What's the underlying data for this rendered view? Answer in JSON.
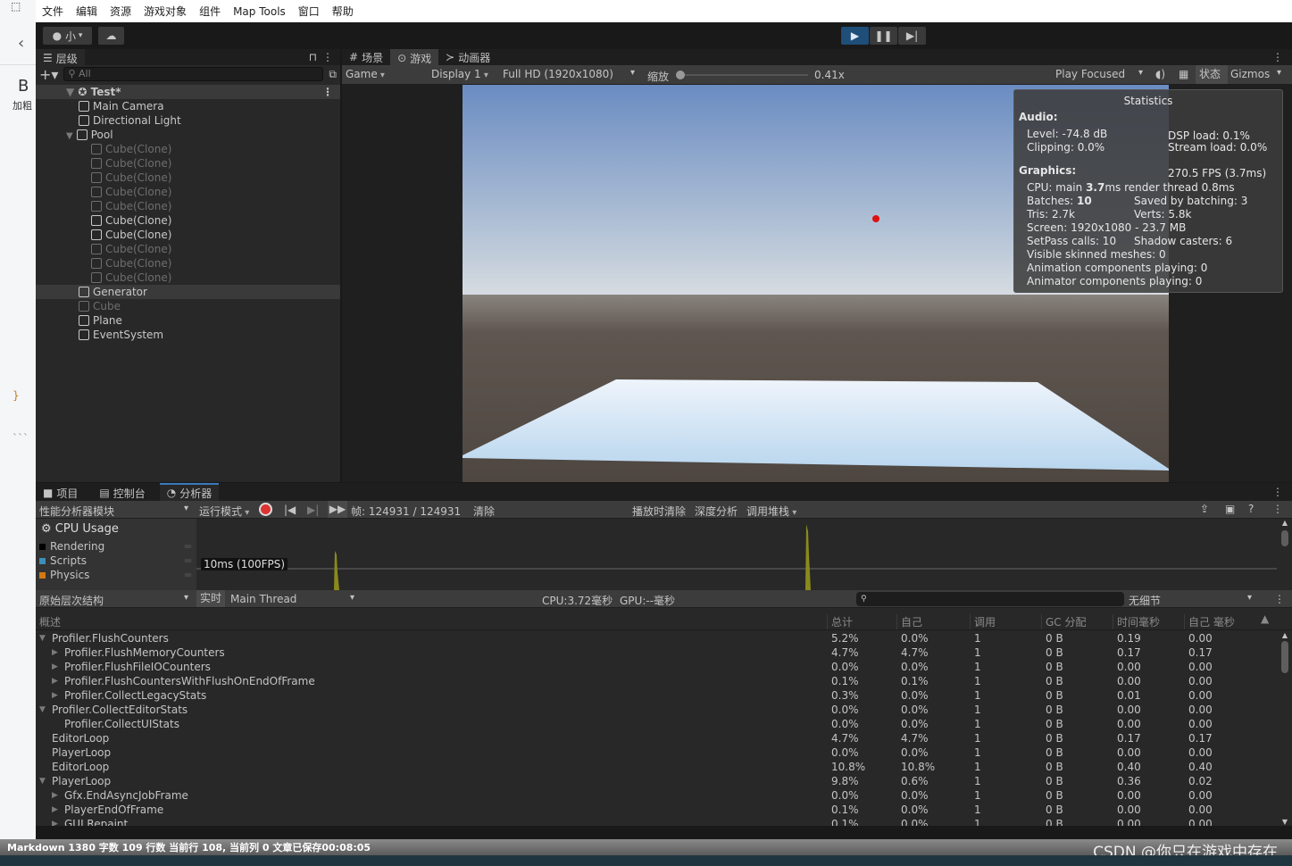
{
  "left_app": {
    "bold_icon": "B",
    "bold_label": "加粗",
    "brace": "}",
    "dots": "```"
  },
  "menu": [
    "文件",
    "编辑",
    "资源",
    "游戏对象",
    "组件",
    "Map Tools",
    "窗口",
    "帮助"
  ],
  "toolbar": {
    "account": "小",
    "play_color": "#1f4e79"
  },
  "hierarchy": {
    "tab": "层级",
    "search_placeholder": "All",
    "scene": "Test*",
    "items": [
      {
        "label": "Main Camera",
        "depth": 1,
        "active": true
      },
      {
        "label": "Directional Light",
        "depth": 1,
        "active": true
      },
      {
        "label": "Pool",
        "depth": 1,
        "active": true,
        "expanded": true
      },
      {
        "label": "Cube(Clone)",
        "depth": 2,
        "active": false
      },
      {
        "label": "Cube(Clone)",
        "depth": 2,
        "active": false
      },
      {
        "label": "Cube(Clone)",
        "depth": 2,
        "active": false
      },
      {
        "label": "Cube(Clone)",
        "depth": 2,
        "active": false
      },
      {
        "label": "Cube(Clone)",
        "depth": 2,
        "active": false
      },
      {
        "label": "Cube(Clone)",
        "depth": 2,
        "active": true
      },
      {
        "label": "Cube(Clone)",
        "depth": 2,
        "active": true
      },
      {
        "label": "Cube(Clone)",
        "depth": 2,
        "active": false
      },
      {
        "label": "Cube(Clone)",
        "depth": 2,
        "active": false
      },
      {
        "label": "Cube(Clone)",
        "depth": 2,
        "active": false
      },
      {
        "label": "Generator",
        "depth": 1,
        "active": true,
        "selected": true
      },
      {
        "label": "Cube",
        "depth": 1,
        "active": false
      },
      {
        "label": "Plane",
        "depth": 1,
        "active": true
      },
      {
        "label": "EventSystem",
        "depth": 1,
        "active": true
      }
    ]
  },
  "game": {
    "tabs": [
      "场景",
      "游戏",
      "动画器"
    ],
    "view": "Game",
    "display": "Display 1",
    "resolution": "Full HD (1920x1080)",
    "zoom_label": "缩放",
    "zoom_value": "0.41x",
    "play_focused": "Play Focused",
    "stats_btn": "状态",
    "gizmos": "Gizmos"
  },
  "stats": {
    "title": "Statistics",
    "audio": "Audio:",
    "level": "Level: -74.8 dB",
    "clipping": "Clipping: 0.0%",
    "dsp": "DSP load: 0.1%",
    "stream": "Stream load: 0.0%",
    "graphics": "Graphics:",
    "fps": "270.5 FPS (3.7ms)",
    "cpu_pre": "CPU: main ",
    "cpu_bold": "3.7",
    "cpu_post": "ms  render thread 0.8ms",
    "batches_pre": "Batches: ",
    "batches_bold": "10",
    "saved": "Saved by batching: 3",
    "tris": "Tris: 2.7k",
    "verts": "Verts: 5.8k",
    "screen": "Screen: 1920x1080 - 23.7 MB",
    "setpass": "SetPass calls: 10",
    "shadow": "Shadow casters: 6",
    "skinned": "Visible skinned meshes: 0",
    "anim": "Animation components playing: 0",
    "animator": "Animator components playing: 0"
  },
  "profiler": {
    "tabs": [
      "项目",
      "控制台",
      "分析器"
    ],
    "modules": "性能分析器模块",
    "mode": "运行模式",
    "frame": "帧:  124931 / 124931",
    "clear": "清除",
    "clear_on_play": "播放时清除",
    "deep": "深度分析",
    "callstack": "调用堆栈",
    "cpu_usage": "CPU Usage",
    "legend": [
      {
        "label": "Rendering",
        "color": "#000000"
      },
      {
        "label": "Scripts",
        "color": "#3d8fb8"
      },
      {
        "label": "Physics",
        "color": "#d17a0f"
      }
    ],
    "threshold": "10ms (100FPS)",
    "view": "原始层次结构",
    "live": "实时",
    "thread": "Main Thread",
    "cpu_time": "CPU:3.72毫秒",
    "gpu_time": "GPU:--毫秒",
    "detail": "无细节",
    "columns": [
      "概述",
      "总计",
      "自己",
      "调用",
      "GC 分配",
      "时间毫秒",
      "自己 毫秒"
    ],
    "rows": [
      {
        "name": "Profiler.FlushCounters",
        "indent": 0,
        "arrow": "open",
        "v": [
          "5.2%",
          "0.0%",
          "1",
          "0 B",
          "0.19",
          "0.00"
        ]
      },
      {
        "name": "Profiler.FlushMemoryCounters",
        "indent": 1,
        "arrow": "closed",
        "v": [
          "4.7%",
          "4.7%",
          "1",
          "0 B",
          "0.17",
          "0.17"
        ]
      },
      {
        "name": "Profiler.FlushFileIOCounters",
        "indent": 1,
        "arrow": "closed",
        "v": [
          "0.0%",
          "0.0%",
          "1",
          "0 B",
          "0.00",
          "0.00"
        ]
      },
      {
        "name": "Profiler.FlushCountersWithFlushOnEndOfFrame",
        "indent": 1,
        "arrow": "closed",
        "v": [
          "0.1%",
          "0.1%",
          "1",
          "0 B",
          "0.00",
          "0.00"
        ]
      },
      {
        "name": "Profiler.CollectLegacyStats",
        "indent": 1,
        "arrow": "closed",
        "v": [
          "0.3%",
          "0.0%",
          "1",
          "0 B",
          "0.01",
          "0.00"
        ]
      },
      {
        "name": "Profiler.CollectEditorStats",
        "indent": 0,
        "arrow": "open",
        "v": [
          "0.0%",
          "0.0%",
          "1",
          "0 B",
          "0.00",
          "0.00"
        ]
      },
      {
        "name": "Profiler.CollectUIStats",
        "indent": 1,
        "arrow": "",
        "v": [
          "0.0%",
          "0.0%",
          "1",
          "0 B",
          "0.00",
          "0.00"
        ]
      },
      {
        "name": "EditorLoop",
        "indent": 0,
        "arrow": "",
        "v": [
          "4.7%",
          "4.7%",
          "1",
          "0 B",
          "0.17",
          "0.17"
        ]
      },
      {
        "name": "PlayerLoop",
        "indent": 0,
        "arrow": "",
        "v": [
          "0.0%",
          "0.0%",
          "1",
          "0 B",
          "0.00",
          "0.00"
        ]
      },
      {
        "name": "EditorLoop",
        "indent": 0,
        "arrow": "",
        "v": [
          "10.8%",
          "10.8%",
          "1",
          "0 B",
          "0.40",
          "0.40"
        ]
      },
      {
        "name": "PlayerLoop",
        "indent": 0,
        "arrow": "open",
        "v": [
          "9.8%",
          "0.6%",
          "1",
          "0 B",
          "0.36",
          "0.02"
        ]
      },
      {
        "name": "Gfx.EndAsyncJobFrame",
        "indent": 1,
        "arrow": "closed",
        "v": [
          "0.0%",
          "0.0%",
          "1",
          "0 B",
          "0.00",
          "0.00"
        ]
      },
      {
        "name": "PlayerEndOfFrame",
        "indent": 1,
        "arrow": "closed",
        "v": [
          "0.1%",
          "0.0%",
          "1",
          "0 B",
          "0.00",
          "0.00"
        ]
      },
      {
        "name": "GUI.Repaint",
        "indent": 1,
        "arrow": "closed",
        "v": [
          "0.1%",
          "0.0%",
          "1",
          "0 B",
          "0.00",
          "0.00"
        ]
      }
    ]
  },
  "status": {
    "left": "Markdown  1380 字数  109 行数  当前行 108, 当前列 0  文章已保存00:08:05",
    "watermark": "CSDN @你只在游戏中存在"
  }
}
